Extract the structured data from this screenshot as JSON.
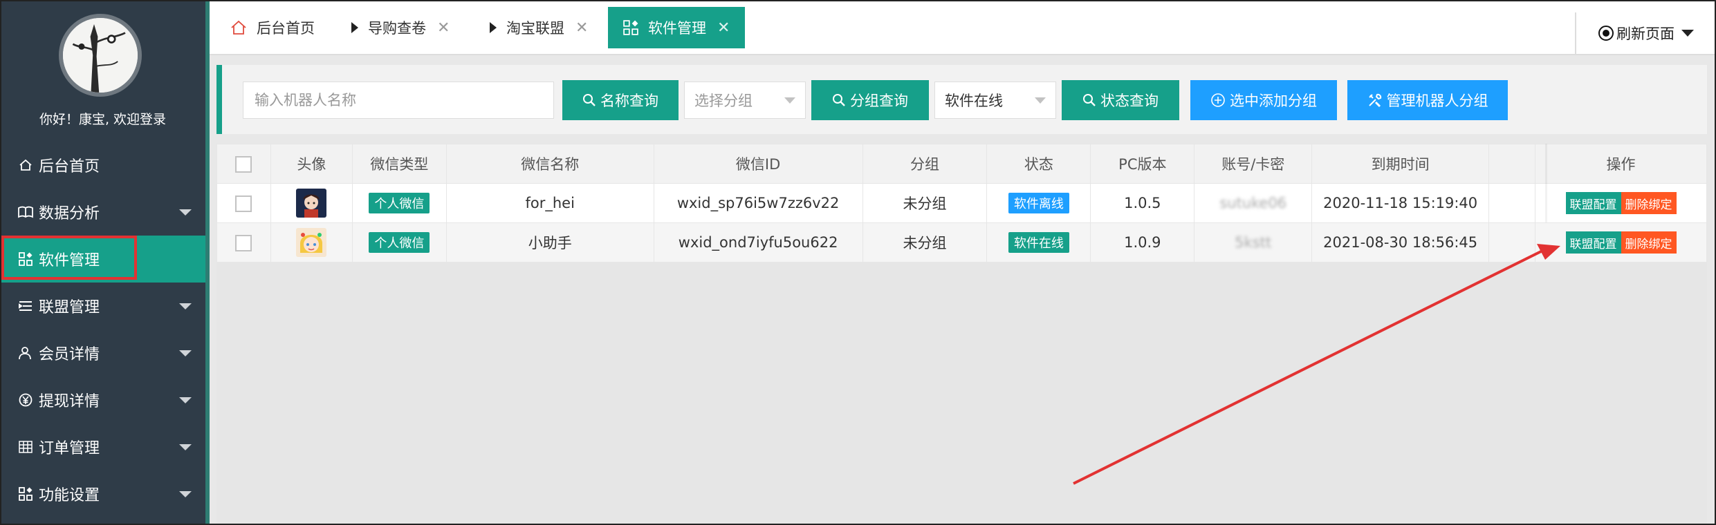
{
  "user": {
    "welcome": "你好！康宝, 欢迎登录"
  },
  "sidebar": {
    "items": [
      {
        "label": "后台首页",
        "icon": "home-icon"
      },
      {
        "label": "数据分析",
        "icon": "book-icon"
      },
      {
        "label": "软件管理",
        "icon": "apps-icon"
      },
      {
        "label": "联盟管理",
        "icon": "list-icon"
      },
      {
        "label": "会员详情",
        "icon": "user-icon"
      },
      {
        "label": "提现详情",
        "icon": "yen-icon"
      },
      {
        "label": "订单管理",
        "icon": "grid-icon"
      },
      {
        "label": "功能设置",
        "icon": "apps-icon"
      }
    ]
  },
  "tabs": [
    {
      "label": "后台首页"
    },
    {
      "label": "导购查卷"
    },
    {
      "label": "淘宝联盟"
    },
    {
      "label": "软件管理"
    }
  ],
  "toolbar": {
    "refresh_label": "刷新页面",
    "name_input_placeholder": "输入机器人名称",
    "name_query": "名称查询",
    "group_select": "选择分组",
    "group_query": "分组查询",
    "status_select": "软件在线",
    "status_query": "状态查询",
    "add_group": "选中添加分组",
    "manage_group": "管理机器人分组"
  },
  "table": {
    "headers": [
      "头像",
      "微信类型",
      "微信名称",
      "微信ID",
      "分组",
      "状态",
      "PC版本",
      "账号/卡密",
      "到期时间",
      "操作"
    ],
    "rows": [
      {
        "type": "个人微信",
        "name": "for_hei",
        "wxid": "wxid_sp76i5w7zz6v22",
        "group": "未分组",
        "status": "软件离线",
        "version": "1.0.5",
        "account": "sutuke06",
        "expire": "2020-11-18 15:19:40",
        "op1": "联盟配置",
        "op2": "删除绑定"
      },
      {
        "type": "个人微信",
        "name": "小助手",
        "wxid": "wxid_ond7iyfu5ou622",
        "group": "未分组",
        "status": "软件在线",
        "version": "1.0.9",
        "account": "5kstt",
        "expire": "2021-08-30 18:56:45",
        "op1": "联盟配置",
        "op2": "删除绑定"
      }
    ]
  },
  "colors": {
    "primary": "#16a08a",
    "sidebar_bg": "#2f3c48",
    "blue": "#1e9fff",
    "orange": "#ff5722",
    "annotation": "#e23232"
  }
}
